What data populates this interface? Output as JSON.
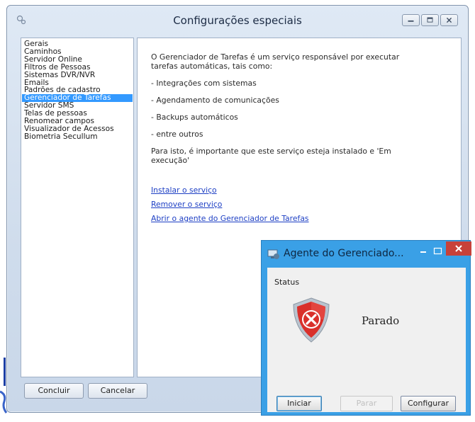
{
  "main_window": {
    "title": "Configurações especiais",
    "nav_items": [
      {
        "label": "Gerais",
        "selected": false
      },
      {
        "label": "Caminhos",
        "selected": false
      },
      {
        "label": "Servidor Online",
        "selected": false
      },
      {
        "label": "Filtros de Pessoas",
        "selected": false
      },
      {
        "label": "Sistemas DVR/NVR",
        "selected": false
      },
      {
        "label": "Emails",
        "selected": false
      },
      {
        "label": "Padrões de cadastro",
        "selected": false
      },
      {
        "label": "Gerenciador de Tarefas",
        "selected": true
      },
      {
        "label": "Servidor SMS",
        "selected": false
      },
      {
        "label": "Telas de pessoas",
        "selected": false
      },
      {
        "label": "Renomear campos",
        "selected": false
      },
      {
        "label": "Visualizador de Acessos",
        "selected": false
      },
      {
        "label": "Biometria Secullum",
        "selected": false
      }
    ],
    "content": {
      "intro_line1": "O Gerenciador de Tarefas é um serviço responsável por executar",
      "intro_line2": "tarefas automáticas, tais como:",
      "bullet1": "- Integrações com sistemas",
      "bullet2": "- Agendamento de comunicações",
      "bullet3": "- Backups automáticos",
      "bullet4": "- entre outros",
      "note_line1": "Para isto, é importante que este serviço esteja instalado e 'Em",
      "note_line2": "execução'",
      "link_install": "Instalar o serviço",
      "link_remove": "Remover o serviço",
      "link_open_agent": "Abrir o agente do Gerenciador de Tarefas"
    },
    "buttons": {
      "finish": "Concluir",
      "cancel": "Cancelar"
    },
    "colors": {
      "selection": "#3399ff",
      "link": "#1d3fc4"
    }
  },
  "agent_window": {
    "title": "Agente do Gerenciado...",
    "status_label": "Status",
    "status_value": "Parado",
    "buttons": {
      "start": "Iniciar",
      "stop": "Parar",
      "configure": "Configurar"
    },
    "colors": {
      "frame": "#3aa0e6",
      "close": "#c7413a",
      "shield": "#d9302b"
    },
    "icons": [
      "agent-app-icon",
      "shield-error-icon",
      "minimize-icon",
      "maximize-icon",
      "close-icon"
    ]
  }
}
